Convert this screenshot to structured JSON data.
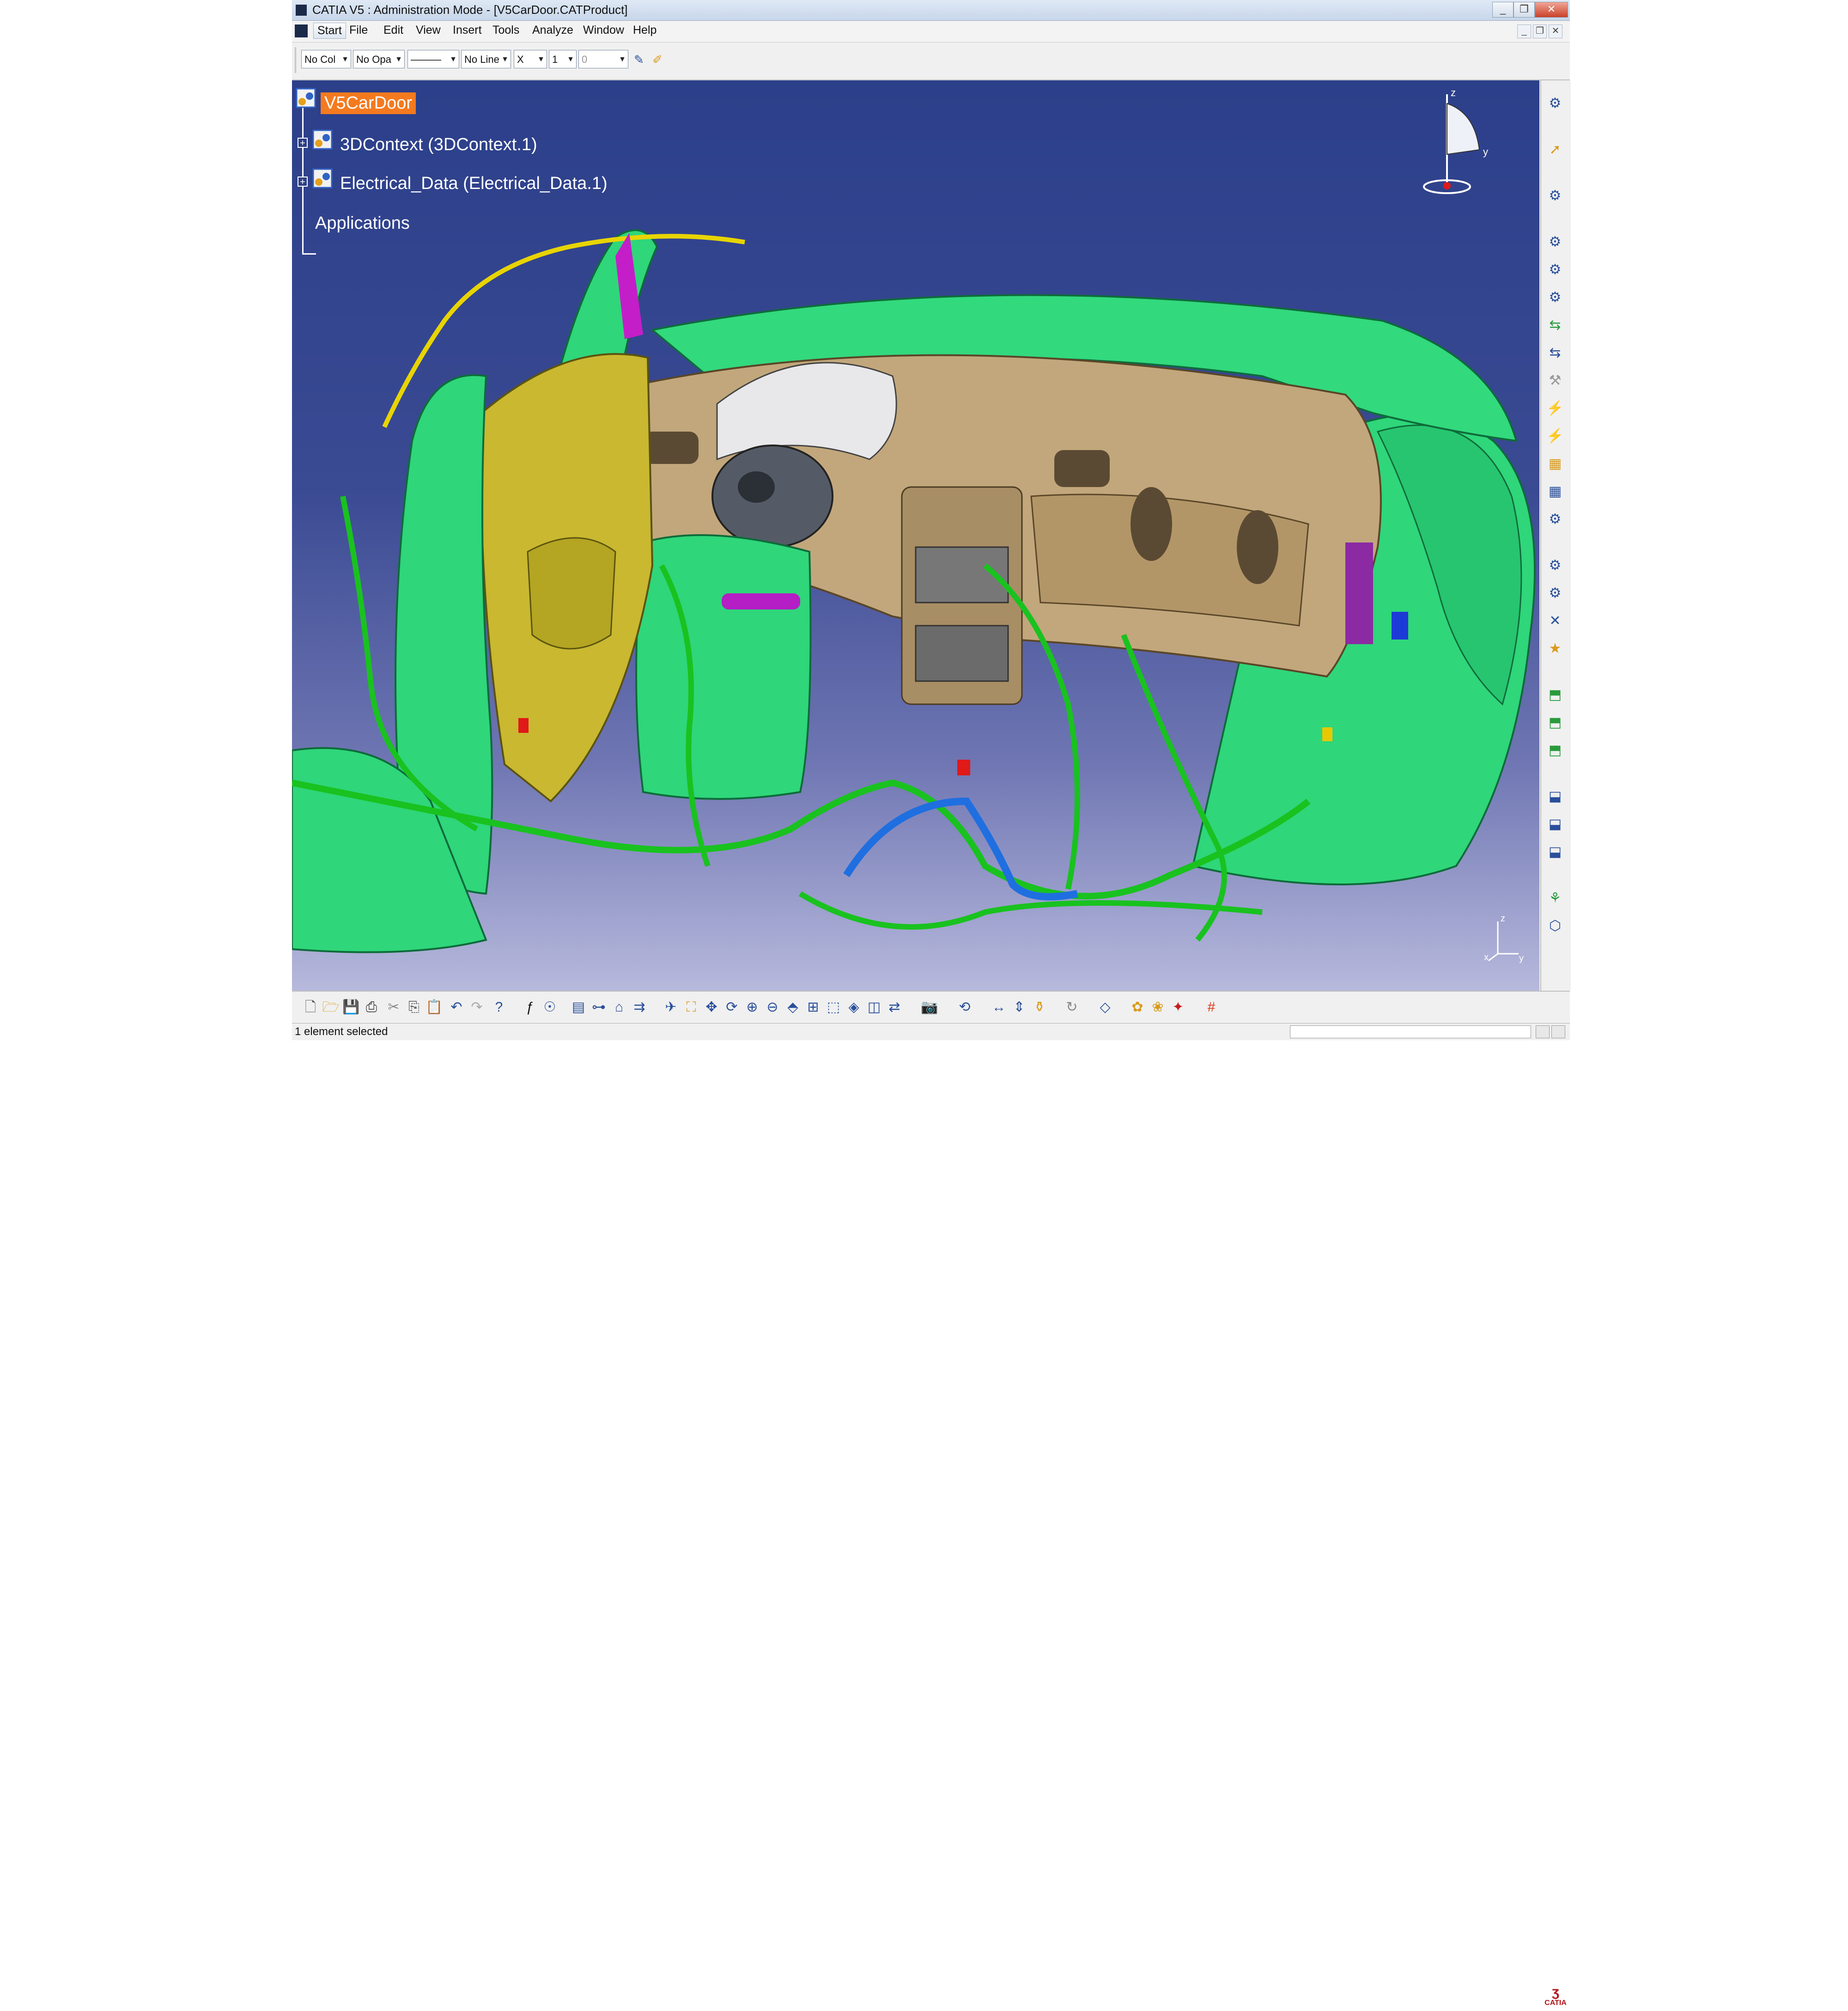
{
  "window": {
    "title": "CATIA V5 : Administration Mode - [V5CarDoor.CATProduct]",
    "controls": {
      "minimize": "_",
      "restore": "❐",
      "close": "✕"
    }
  },
  "menu": {
    "items": [
      "Start",
      "File",
      "Edit",
      "View",
      "Insert",
      "Tools",
      "Analyze",
      "Window",
      "Help"
    ],
    "doc_controls": {
      "minimize": "_",
      "restore": "❐",
      "close": "✕"
    }
  },
  "toolbar": {
    "color_combo": "No Col",
    "opacity_combo": "No Opa",
    "linetype_combo": "———",
    "lineweight_combo": "No Line",
    "point_combo": "X",
    "layer_combo": "1",
    "value_combo": "0"
  },
  "tree": {
    "root": "V5CarDoor",
    "children": [
      {
        "label": "3DContext (3DContext.1)"
      },
      {
        "label": "Electrical_Data (Electrical_Data.1)"
      }
    ],
    "applications": "Applications"
  },
  "compass": {
    "z": "z",
    "y": "y"
  },
  "axis": {
    "z": "z",
    "x": "x",
    "y": "y"
  },
  "status": {
    "message": "1 element selected"
  },
  "brand": {
    "logo_text": "CATIA"
  },
  "colors": {
    "viewport_top": "#2c3f8a",
    "viewport_bottom": "#b7b9dc",
    "selection": "#f47a1f",
    "body_green": "#2fd67a",
    "harness_green": "#19c21f",
    "dash_tan": "#c2a77c",
    "door_yellow": "#c9b830",
    "harness_blue": "#1f6fe0"
  }
}
